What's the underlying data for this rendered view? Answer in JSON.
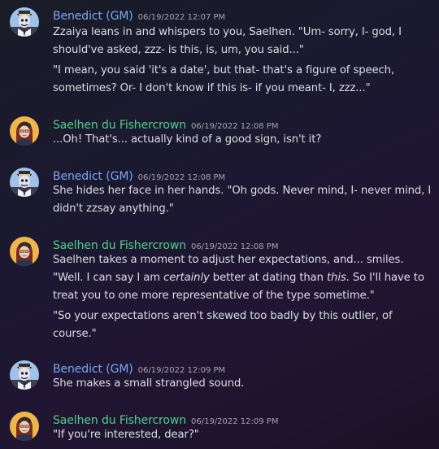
{
  "messages": [
    {
      "author": "Benedict (GM)",
      "timestamp": "06/19/2022 12:07 PM",
      "avatar": "gm-avatar",
      "lines": [
        "Zzaiya leans in and whispers to you, Saelhen. \"Um- sorry, I- god, I",
        "should've asked, zzz- is this, is, um, you said...\"",
        "\"I mean, you said 'it's a date', but that- that's a figure of speech,",
        "sometimes? Or- I don't know if this is- if you meant- I, zzz...\""
      ]
    },
    {
      "author": "Saelhen du Fishercrown",
      "timestamp": "06/19/2022 12:08 PM",
      "avatar": "saelhen-avatar",
      "lines": [
        "...Oh! That's... actually kind of a good sign, isn't it?"
      ]
    },
    {
      "author": "Benedict (GM)",
      "timestamp": "06/19/2022 12:08 PM",
      "avatar": "gm-avatar",
      "lines": [
        "She hides her face in her hands. \"Oh gods. Never mind, I- never mind, I",
        "didn't zzsay anything.\""
      ]
    },
    {
      "author": "Saelhen du Fishercrown",
      "timestamp": "06/19/2022 12:08 PM",
      "avatar": "saelhen-avatar",
      "lines": [
        "Saelhen takes a moment to adjust her expectations, and... smiles.",
        "\"Well. I can say I am ",
        "certainly",
        " better at dating than ",
        "this",
        ". So I'll have to",
        "treat you to one more representative of the type sometime.\"",
        "\"So your expectations aren't skewed too badly by this outlier, of",
        "course.\""
      ]
    },
    {
      "author": "Benedict (GM)",
      "timestamp": "06/19/2022 12:09 PM",
      "avatar": "gm-avatar",
      "lines": [
        "She makes a small strangled sound."
      ]
    },
    {
      "author": "Saelhen du Fishercrown",
      "timestamp": "06/19/2022 12:09 PM",
      "avatar": "saelhen-avatar",
      "lines": [
        "\"If you're interested, dear?\""
      ]
    }
  ],
  "colors": {
    "gm_name": "#7ba7f5",
    "pc_name": "#4fd18b",
    "timestamp": "#a3a5b1",
    "text": "#dcdde6"
  }
}
